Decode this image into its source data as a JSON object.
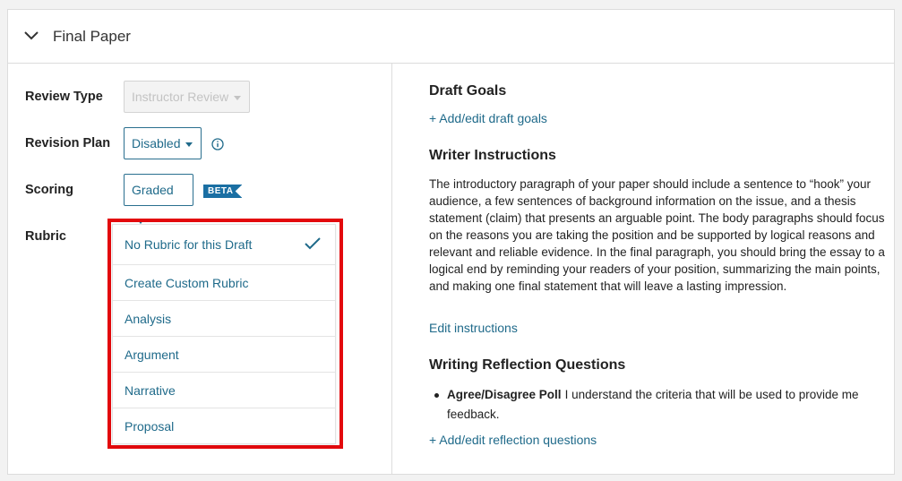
{
  "section": {
    "title": "Final Paper"
  },
  "form": {
    "review_type": {
      "label": "Review Type",
      "value": "Instructor Review"
    },
    "revision_plan": {
      "label": "Revision Plan",
      "value": "Disabled"
    },
    "scoring": {
      "label": "Scoring",
      "value": "Graded",
      "badge": "BETA"
    },
    "rubric": {
      "label": "Rubric"
    }
  },
  "rubric_menu": {
    "items": [
      {
        "label": "No Rubric for this Draft",
        "selected": true
      },
      {
        "label": "Create Custom Rubric"
      },
      {
        "label": "Analysis"
      },
      {
        "label": "Argument"
      },
      {
        "label": "Narrative"
      },
      {
        "label": "Proposal"
      }
    ]
  },
  "draft_goals": {
    "heading": "Draft Goals",
    "link": "+ Add/edit draft goals"
  },
  "writer_instructions": {
    "heading": "Writer Instructions",
    "text": "The introductory paragraph of your paper should include a sentence to “hook” your audience, a few sentences of background information on the issue, and a thesis statement (claim) that presents an arguable point. The body paragraphs should focus on the reasons you are taking the position and be supported by logical reasons and relevant and reliable evidence. In the final paragraph, you should bring the essay to a logical end by reminding your readers of your position, summarizing the main points, and making one final statement that will leave a lasting impression.",
    "edit_link": "Edit instructions"
  },
  "reflection": {
    "heading": "Writing Reflection Questions",
    "items": [
      {
        "title": "Agree/Disagree Poll",
        "text": "I understand the criteria that will be used to provide me feedback."
      }
    ],
    "link": "+ Add/edit reflection questions"
  },
  "colors": {
    "accent": "#1f6a8a",
    "highlight": "#e3090c",
    "beta_badge": "#1a6fa3"
  }
}
